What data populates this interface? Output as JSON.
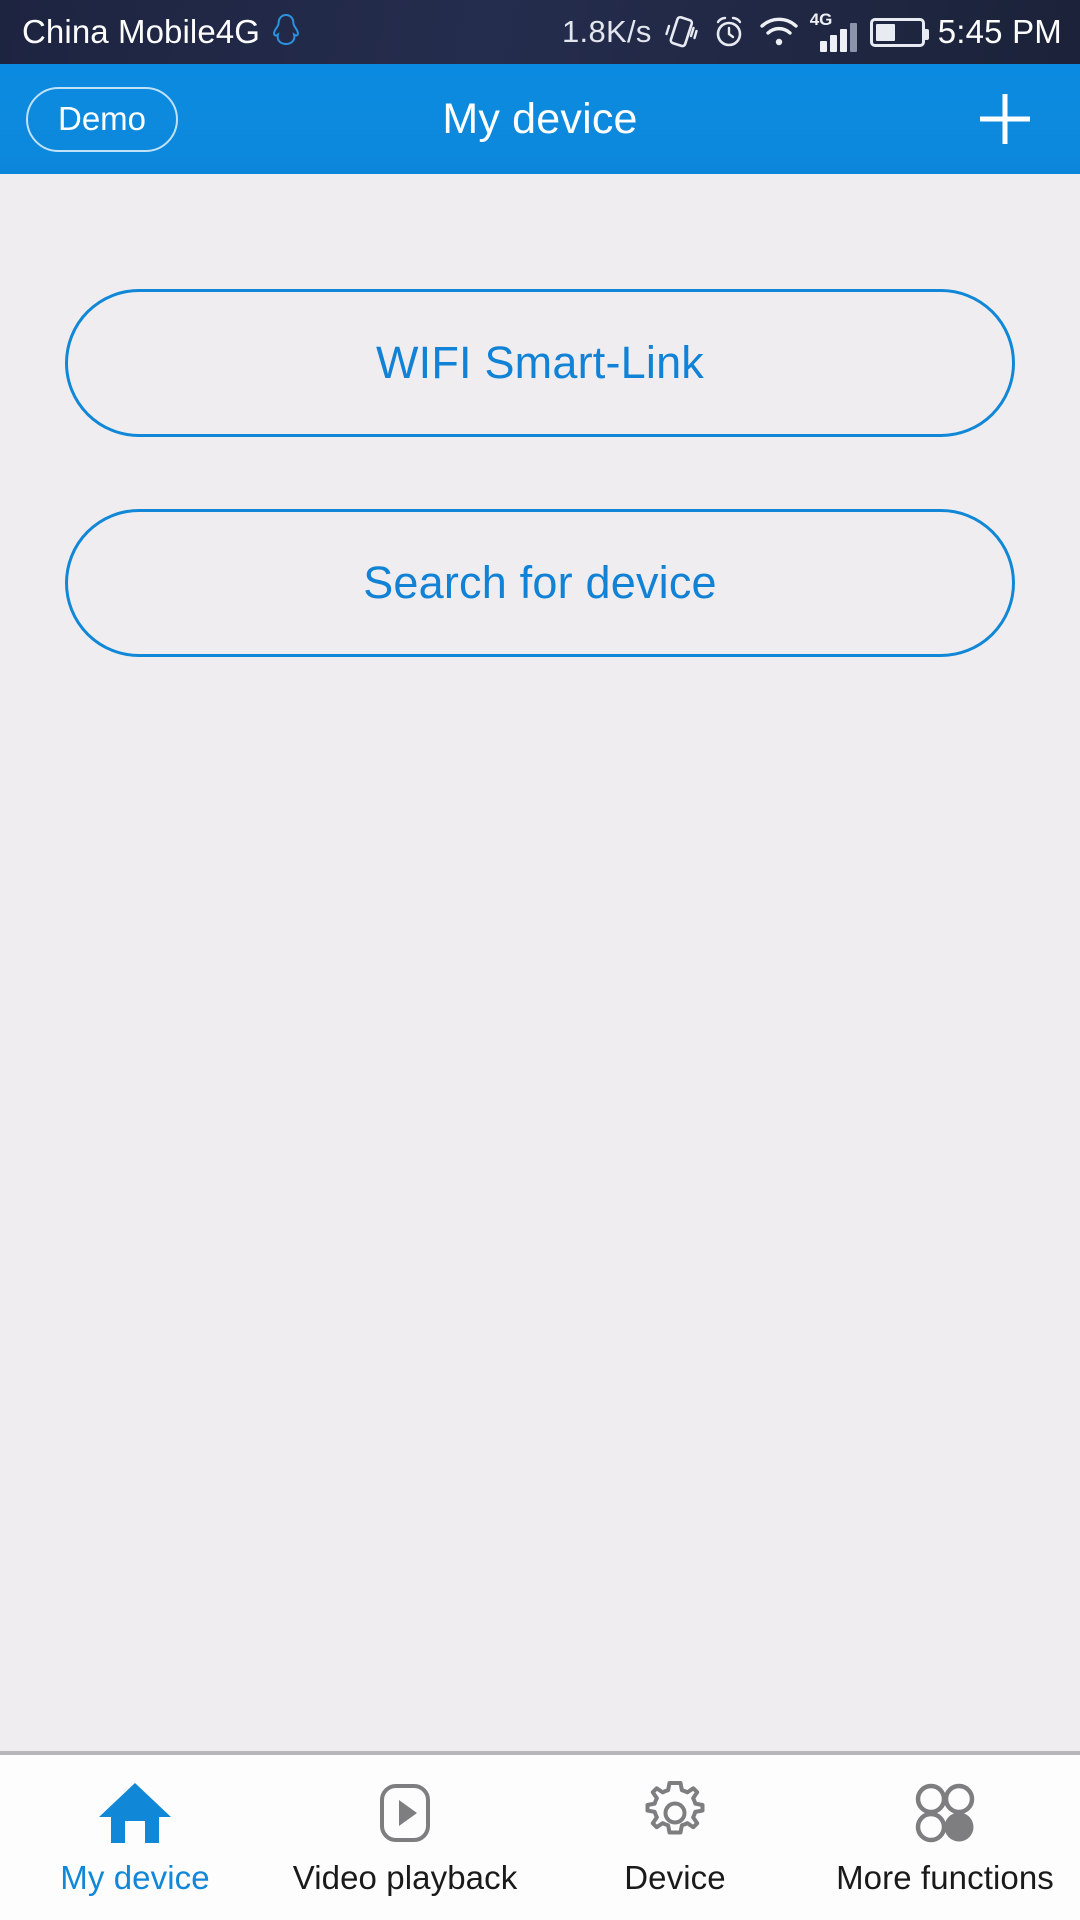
{
  "status_bar": {
    "carrier": "China Mobile4G",
    "qq_icon": "qq-penguin-icon",
    "network_speed": "1.8K/s",
    "vibrate_icon": "vibrate-icon",
    "alarm_icon": "alarm-clock-icon",
    "wifi_icon": "wifi-icon",
    "network_type": "4G",
    "signal_icon": "signal-bars-icon",
    "signal_bars_filled": 3,
    "signal_bars_total": 4,
    "battery_icon": "battery-icon",
    "battery_percent": 45,
    "time": "5:45 PM"
  },
  "header": {
    "demo_label": "Demo",
    "title": "My device",
    "add_icon": "plus-icon"
  },
  "main": {
    "buttons": [
      {
        "label": "WIFI Smart-Link",
        "name": "wifi-smart-link-button"
      },
      {
        "label": "Search for device",
        "name": "search-for-device-button"
      }
    ]
  },
  "tabbar": {
    "items": [
      {
        "label": "My device",
        "icon": "home-icon",
        "active": true
      },
      {
        "label": "Video playback",
        "icon": "play-video-icon",
        "active": false
      },
      {
        "label": "Device",
        "icon": "gear-icon",
        "active": false
      },
      {
        "label": "More functions",
        "icon": "four-circles-icon",
        "active": false
      }
    ]
  },
  "colors": {
    "accent_blue": "#1187d7",
    "header_blue": "#0d8ade",
    "content_bg": "#efedef",
    "icon_gray": "#7e7e80",
    "status_bar_bg": "#232b4a"
  }
}
